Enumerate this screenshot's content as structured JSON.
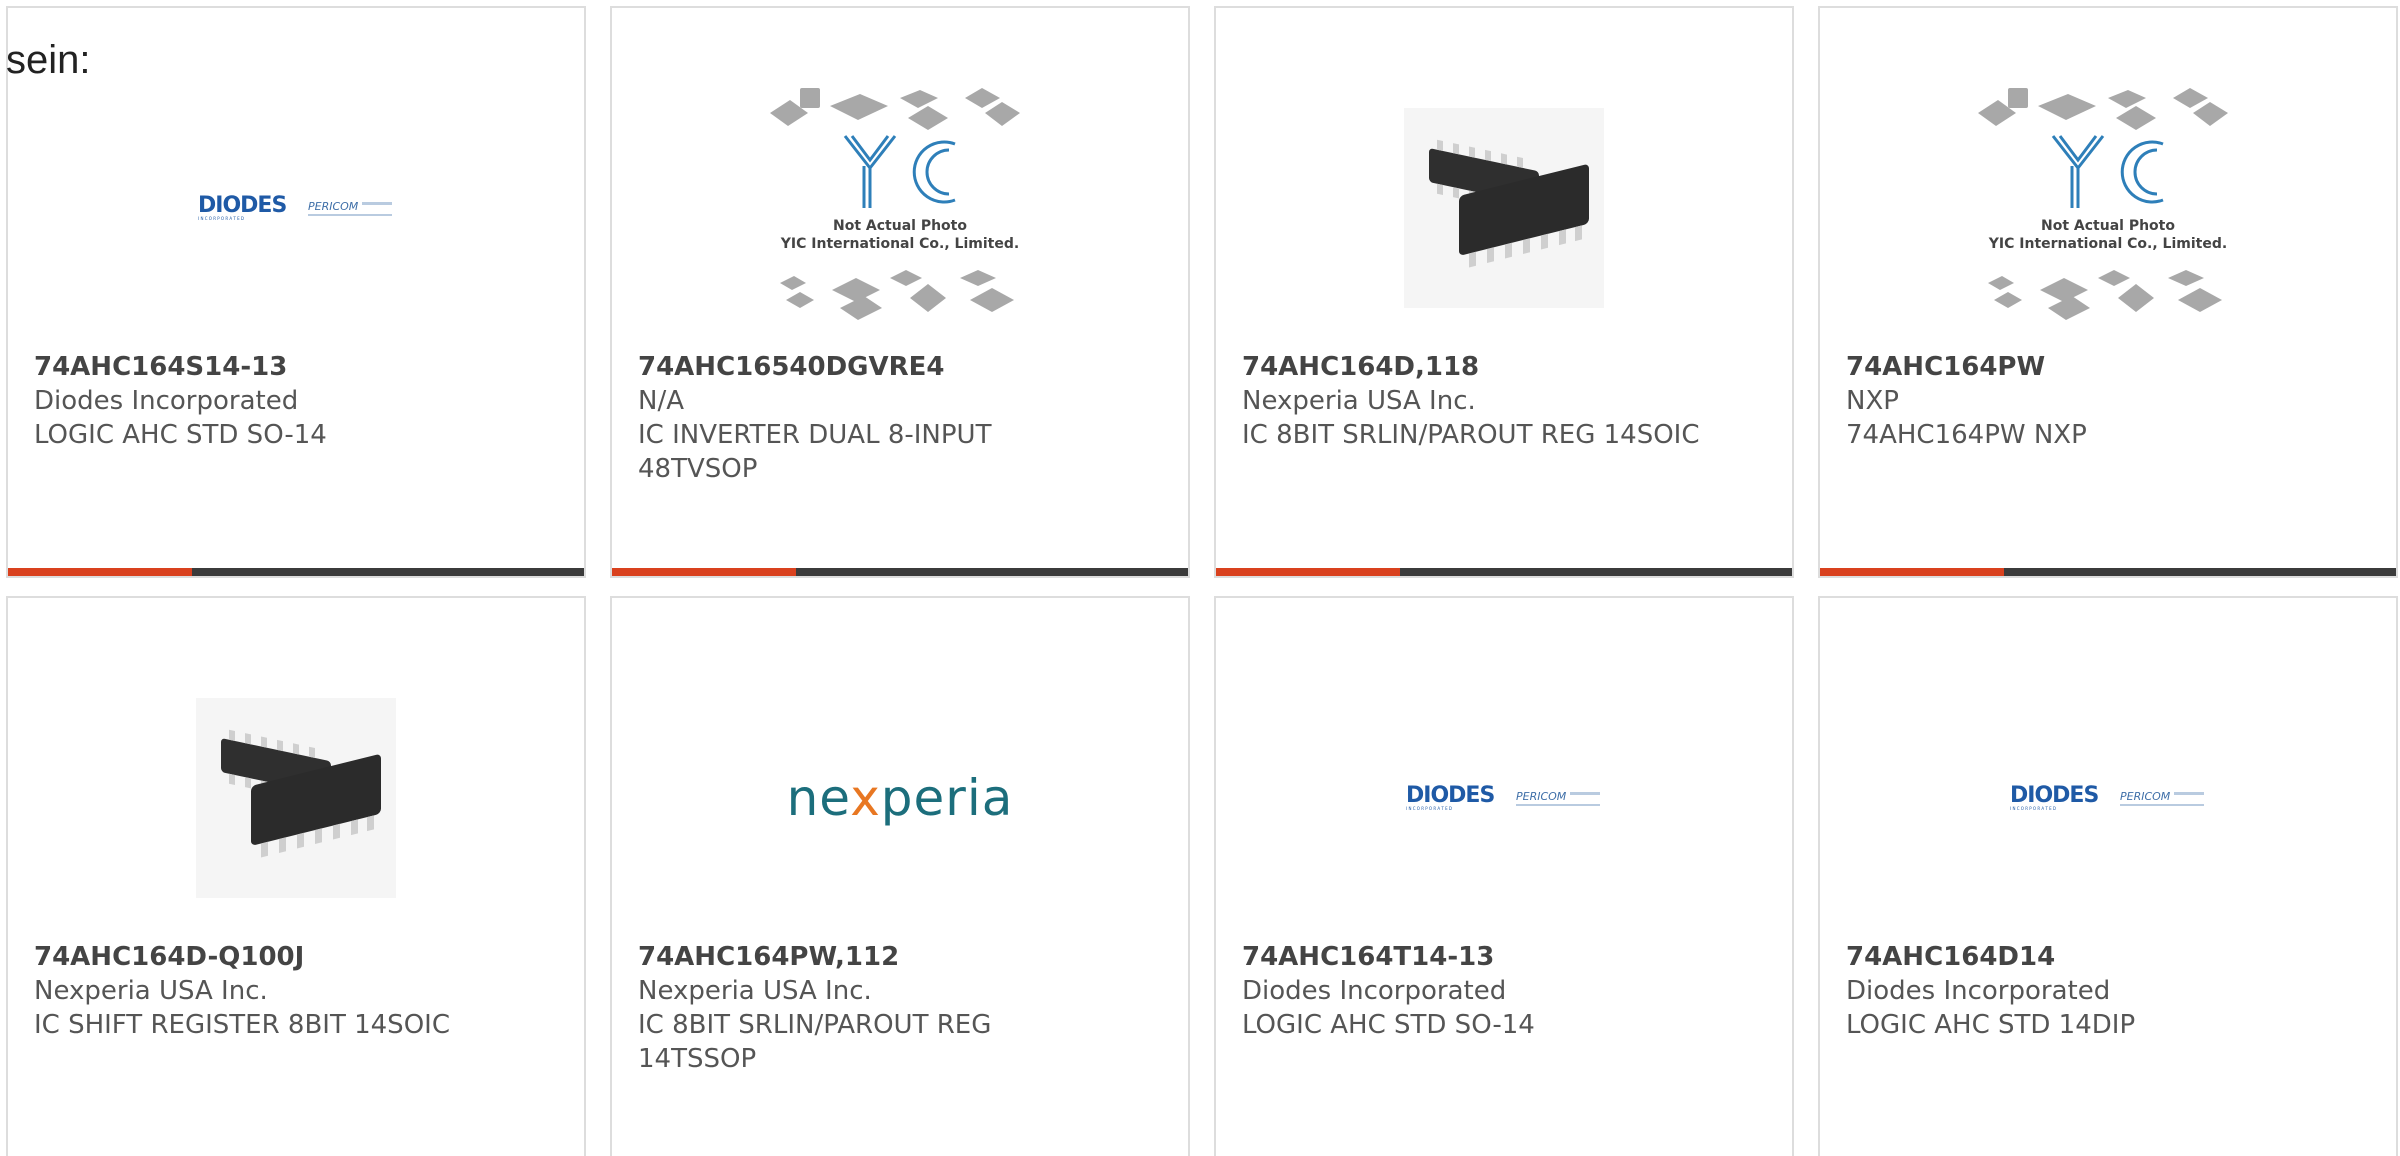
{
  "cut_text": "sein:",
  "colors": {
    "accent": "#d9411e",
    "bar": "#3b3b3b",
    "diodes_blue": "#1f5aa6",
    "nexperia_teal": "#1c6e7c"
  },
  "products": [
    {
      "part": "74AHC164S14-13",
      "manufacturer": "Diodes Incorporated",
      "description": "LOGIC AHC STD SO-14",
      "image": "diodes-pericom-logo"
    },
    {
      "part": "74AHC16540DGVRE4",
      "manufacturer": "N/A",
      "description": "IC INVERTER DUAL 8-INPUT 48TVSOP",
      "image": "yic-placeholder",
      "image_text": [
        "Not Actual Photo",
        "YIC International Co., Limited."
      ]
    },
    {
      "part": "74AHC164D,118",
      "manufacturer": "Nexperia USA Inc.",
      "description": "IC 8BIT SRLIN/PAROUT REG 14SOIC",
      "image": "soic-chip-photo"
    },
    {
      "part": "74AHC164PW",
      "manufacturer": "NXP",
      "description": "74AHC164PW NXP",
      "image": "yic-placeholder",
      "image_text": [
        "Not Actual Photo",
        "YIC International Co., Limited."
      ]
    },
    {
      "part": "74AHC164D-Q100J",
      "manufacturer": "Nexperia USA Inc.",
      "description": "IC SHIFT REGISTER 8BIT 14SOIC",
      "image": "soic-chip-photo"
    },
    {
      "part": "74AHC164PW,112",
      "manufacturer": "Nexperia USA Inc.",
      "description": "IC 8BIT SRLIN/PAROUT REG 14TSSOP",
      "image": "nexperia-logo",
      "logo_text": [
        "ne",
        "x",
        "peria"
      ]
    },
    {
      "part": "74AHC164T14-13",
      "manufacturer": "Diodes Incorporated",
      "description": "LOGIC AHC STD SO-14",
      "image": "diodes-pericom-logo"
    },
    {
      "part": "74AHC164D14",
      "manufacturer": "Diodes Incorporated",
      "description": "LOGIC AHC STD 14DIP",
      "image": "diodes-pericom-logo"
    }
  ]
}
